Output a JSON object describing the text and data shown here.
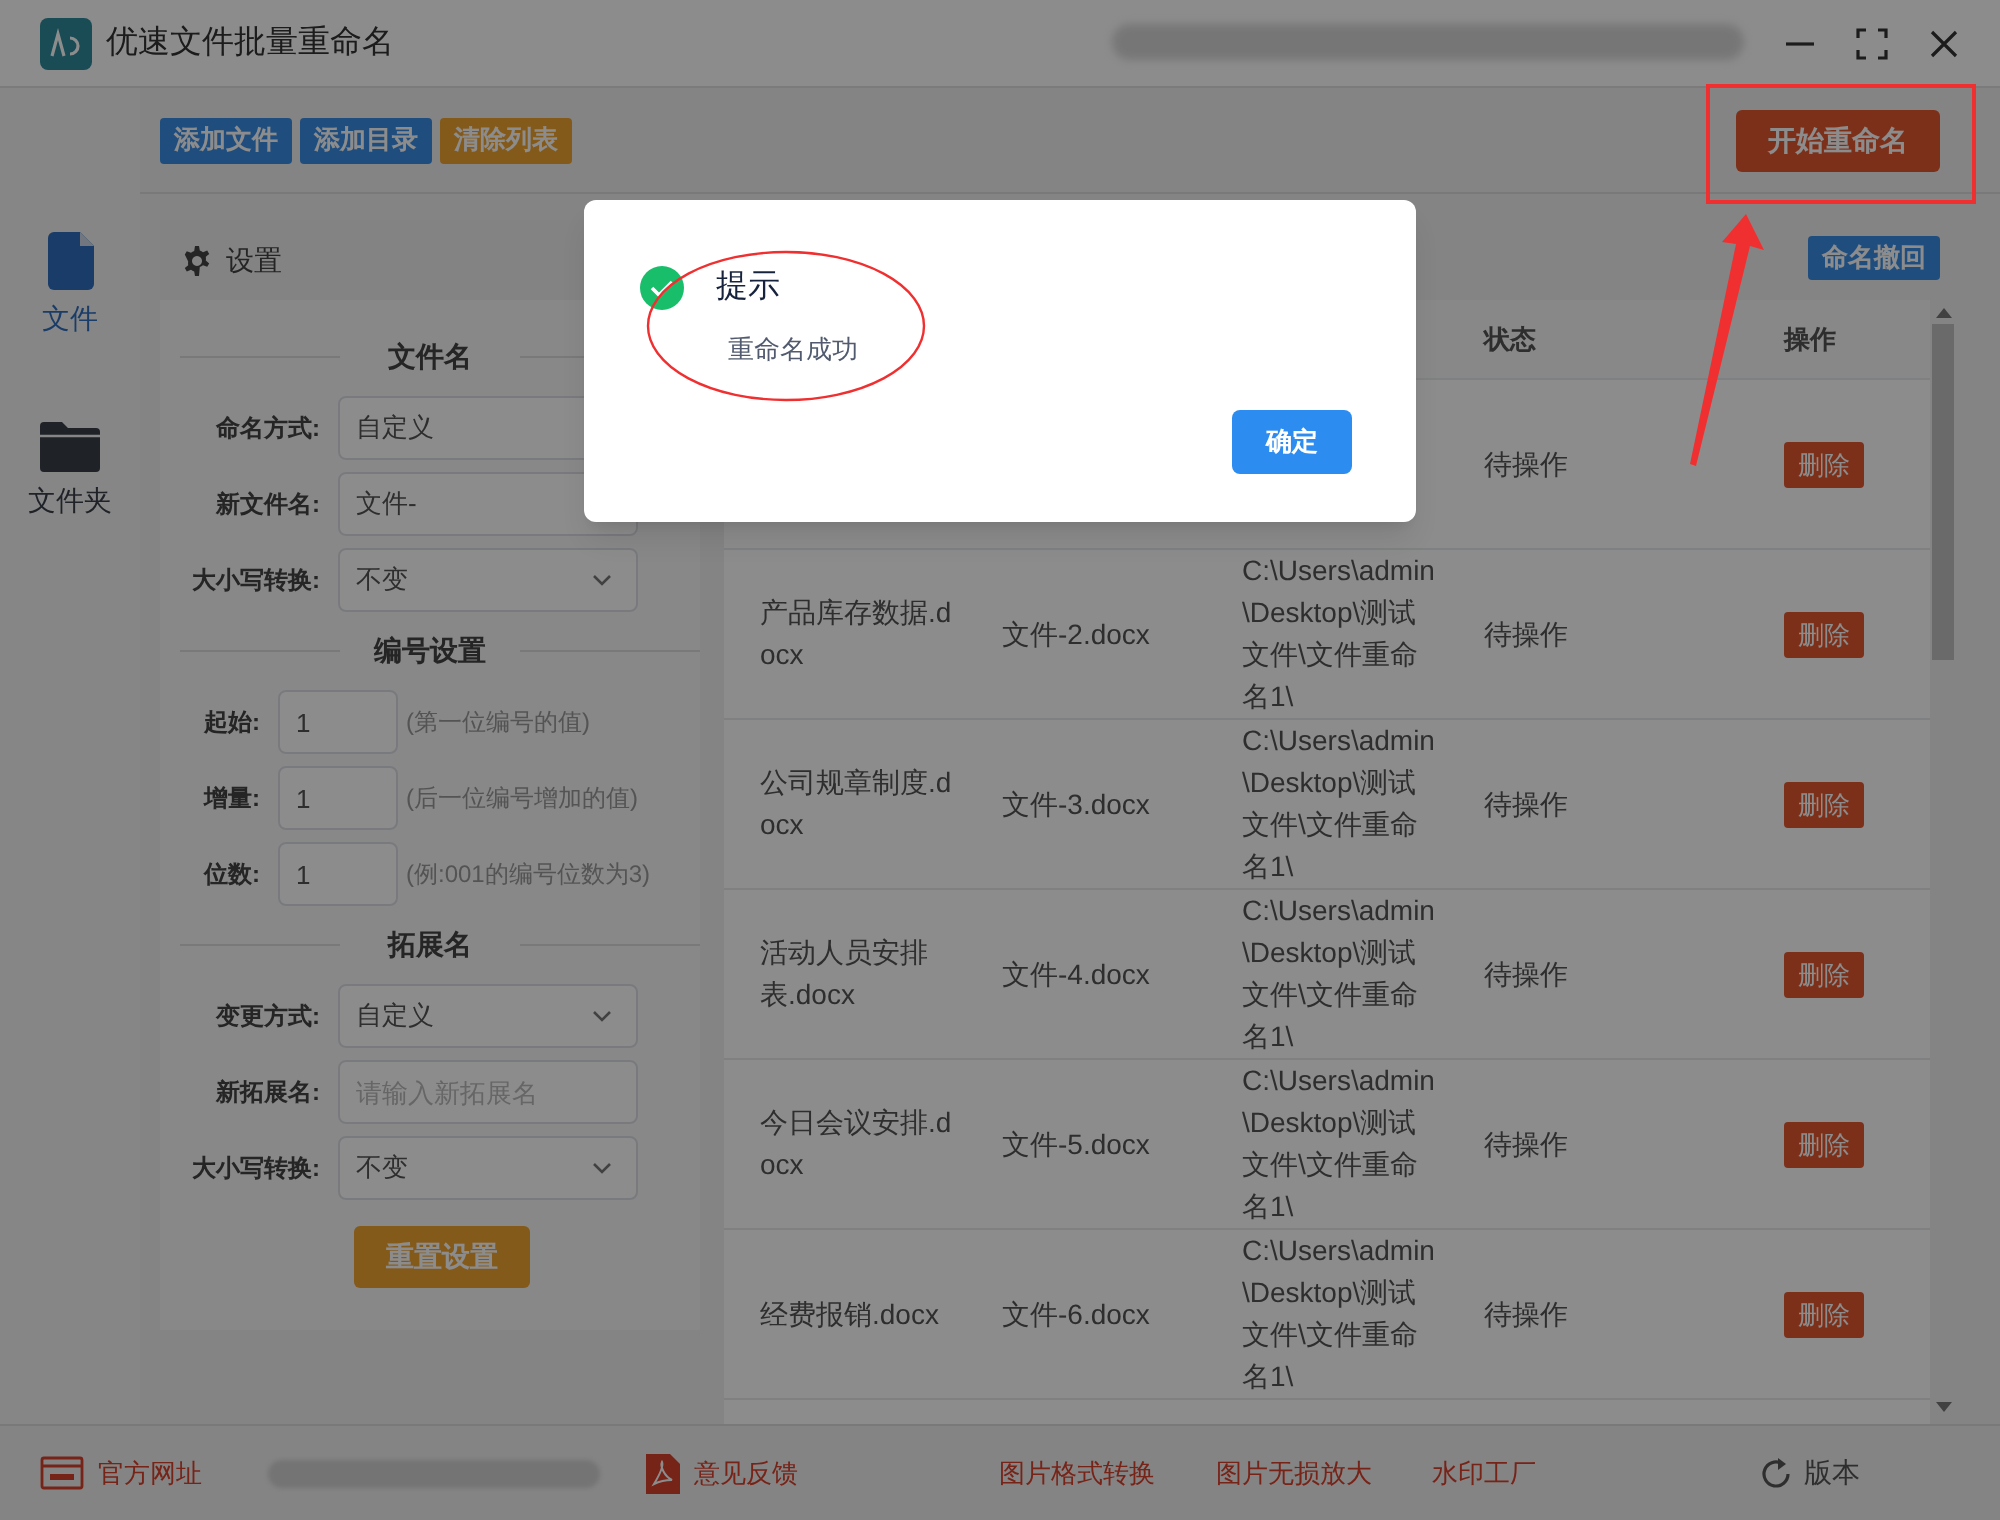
{
  "window": {
    "title": "优速文件批量重命名"
  },
  "toolbar": {
    "buttons": [
      {
        "label": "添加文件",
        "kind": "blue"
      },
      {
        "label": "添加目录",
        "kind": "blue"
      },
      {
        "label": "清除列表",
        "kind": "orange"
      }
    ],
    "start_button": "开始重命名"
  },
  "sidebar": {
    "items": [
      {
        "label": "文件",
        "kind": "file",
        "selected": true
      },
      {
        "label": "文件夹",
        "kind": "folder",
        "selected": false
      }
    ]
  },
  "settings": {
    "title": "设置",
    "sections": [
      {
        "heading": "文件名",
        "fields": [
          {
            "label": "命名方式:",
            "kind": "text",
            "value": "自定义"
          },
          {
            "label": "新文件名:",
            "kind": "text",
            "value": "文件-"
          },
          {
            "label": "大小写转换:",
            "kind": "select",
            "value": "不变"
          }
        ]
      },
      {
        "heading": "编号设置",
        "fields": [
          {
            "label": "起始:",
            "kind": "number",
            "value": "1",
            "hint": "(第一位编号的值)"
          },
          {
            "label": "增量:",
            "kind": "number",
            "value": "1",
            "hint": "(后一位编号增加的值)"
          },
          {
            "label": "位数:",
            "kind": "number",
            "value": "1",
            "hint": "(例:001的编号位数为3)"
          }
        ]
      },
      {
        "heading": "拓展名",
        "fields": [
          {
            "label": "变更方式:",
            "kind": "select",
            "value": "自定义"
          },
          {
            "label": "新拓展名:",
            "kind": "text",
            "placeholder": "请输入新拓展名"
          },
          {
            "label": "大小写转换:",
            "kind": "select",
            "value": "不变"
          }
        ]
      }
    ],
    "reset_button": "重置设置"
  },
  "table": {
    "undo_button": "命名撤回",
    "columns": [
      "状态",
      "操作"
    ],
    "rows": [
      {
        "status": "待操作",
        "action": "删除"
      },
      {
        "original": "产品库存数据.docx",
        "new_name": "文件-2.docx",
        "path": "C:\\Users\\admin\\Desktop\\测试文件\\文件重命名1\\",
        "status": "待操作",
        "action": "删除"
      },
      {
        "original": "公司规章制度.docx",
        "new_name": "文件-3.docx",
        "path": "C:\\Users\\admin\\Desktop\\测试文件\\文件重命名1\\",
        "status": "待操作",
        "action": "删除"
      },
      {
        "original": "活动人员安排表.docx",
        "new_name": "文件-4.docx",
        "path": "C:\\Users\\admin\\Desktop\\测试文件\\文件重命名1\\",
        "status": "待操作",
        "action": "删除"
      },
      {
        "original": "今日会议安排.docx",
        "new_name": "文件-5.docx",
        "path": "C:\\Users\\admin\\Desktop\\测试文件\\文件重命名1\\",
        "status": "待操作",
        "action": "删除"
      },
      {
        "original": "经费报销.docx",
        "new_name": "文件-6.docx",
        "path": "C:\\Users\\admin\\Desktop\\测试文件\\文件重命名1\\",
        "status": "待操作",
        "action": "删除"
      }
    ]
  },
  "footer": {
    "links": [
      {
        "label": "官方网址",
        "kind": "web"
      },
      {
        "kind": "redacted"
      },
      {
        "label": "意见反馈",
        "kind": "pdf"
      },
      {
        "label": "图片格式转换",
        "kind": "plain"
      },
      {
        "label": "图片无损放大",
        "kind": "plain"
      },
      {
        "label": "水印工厂",
        "kind": "plain"
      }
    ],
    "version": "版本"
  },
  "dialog": {
    "title": "提示",
    "message": "重命名成功",
    "button": "确定"
  },
  "annotations": [
    {
      "kind": "rectangle"
    },
    {
      "kind": "ellipse"
    },
    {
      "kind": "arrow"
    }
  ]
}
